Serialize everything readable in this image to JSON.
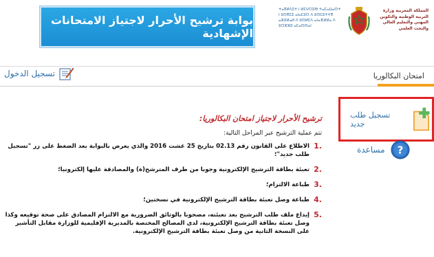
{
  "header": {
    "portal_title": "بوابة ترشيح الأحرار لاجتياز الامتحانات الإشهادية",
    "ministry_ar": "المملكة المغربية وزارة التربية الوطنية والتكوين المهني والتعليم العالي والبحث العلمي",
    "ministry_en": "ⵜⴰⴳⵍⴷⵉⵜ ⵏ ⵍⵎⵖⵔⵉⴱ ⵜⴰⵎⴰⵡⴰⵙⵜ ⵏ ⵓⵙⴳⵎⵉ ⴰⵏⴰⵎⵓⵔ ⴷ ⵓⵙⵎⵓⵜⵜⴳ ⴰⵣⵓⵍⴰⵍ ⴷ ⵓⵙⵍⵎⴷ ⴰⵏⴰⴼⵍⵍⴰ ⴷ ⵓⵔⵣⵣⵓ ⴰⵎⴰⵙⵙⴰⵏ"
  },
  "login": {
    "label": "تسجيل الدخول"
  },
  "tabs": [
    {
      "label": "امتحان البكالوريا",
      "active": true
    }
  ],
  "sidebar": {
    "new_application": "تسجيل طلب جديد",
    "help": "مساعدة"
  },
  "main": {
    "title": "ترشيح الأحرار لاجتياز امتحان البكالوريا:",
    "intro": "تتم عملية الترشيح عبر المراحل التالية:",
    "steps": [
      {
        "num": "1.",
        "text": "الاطلاع على القانون رقم 02.13 بتاريخ 25 غشت 2016 والذي يعرض بالبوابة بعد الضغط على زر \"تسجيل طلب جديد\"؛"
      },
      {
        "num": "2.",
        "text": "تعبئة بطاقة الترشيح الإلكترونية وجوبا من طرف المترشح(ة) والمصادقة عليها إلكترونيا؛"
      },
      {
        "num": "3.",
        "text": "طباعة الالتزام؛"
      },
      {
        "num": "4.",
        "text": "طباعة وصل تعبئة بطاقة الترشيح الإلكترونية في نسختين؛"
      },
      {
        "num": "5.",
        "text": "إيداع ملف طلب الترشيح بعد تعبئته، مصحوبا بالوثائق الضرورية مع الالتزام المصادق على صحة توقيعه وكذا وصل تعبئة بطاقة الترشيح الإلكترونية، لدى المصالح المختصة بالمديرية الإقليمية للوزارة مقابل التأشير على النسخة الثانية من وصل تعبئة بطاقة الترشيح الإلكترونية."
      }
    ]
  },
  "colors": {
    "accent_blue": "#1b8ed3",
    "highlight_red": "#e02424",
    "tab_orange": "#f4a11f",
    "title_red": "#c1272d",
    "link_blue": "#2f6fa8"
  }
}
